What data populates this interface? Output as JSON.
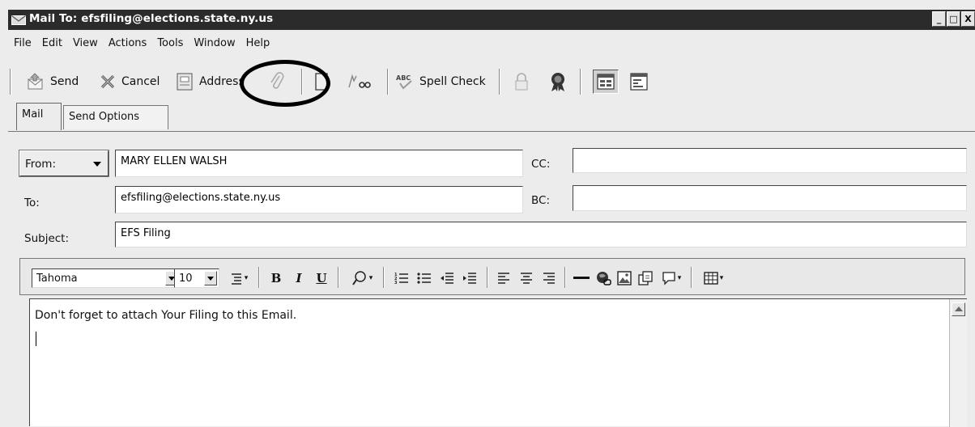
{
  "window": {
    "title": "Mail To: efsfiling@elections.state.ny.us",
    "controls": {
      "minimize": "_",
      "maximize": "□",
      "close": "X"
    }
  },
  "menu": [
    "File",
    "Edit",
    "View",
    "Actions",
    "Tools",
    "Window",
    "Help"
  ],
  "toolbar": {
    "send_label": "Send",
    "cancel_label": "Cancel",
    "address_label": "Address",
    "spellcheck_label": "Spell Check",
    "icons": [
      "send-icon",
      "cancel-icon",
      "address-book-icon",
      "paperclip-attach-icon",
      "checkbox-icon",
      "signature-icon",
      "spellcheck-icon",
      "lock-icon",
      "seal-icon",
      "view-layout-icon",
      "view-form-icon"
    ]
  },
  "tabs": [
    {
      "label": "Mail",
      "active": true
    },
    {
      "label": "Send Options",
      "active": false
    }
  ],
  "fields": {
    "from_label": "From:",
    "from_value": "MARY ELLEN WALSH",
    "to_label": "To:",
    "to_value": "efsfiling@elections.state.ny.us",
    "cc_label": "CC:",
    "cc_value": "",
    "bc_label": "BC:",
    "bc_value": "",
    "subject_label": "Subject:",
    "subject_value": "EFS Filing"
  },
  "format": {
    "font": "Tahoma",
    "size": "10",
    "bold": "B",
    "italic": "I",
    "underline": "U"
  },
  "message": {
    "body": "Don't forget to attach Your Filing to this Email."
  },
  "colors": {
    "titlebar": "#2b2b2b",
    "chrome": "#ececec",
    "highlight": "#000000"
  }
}
